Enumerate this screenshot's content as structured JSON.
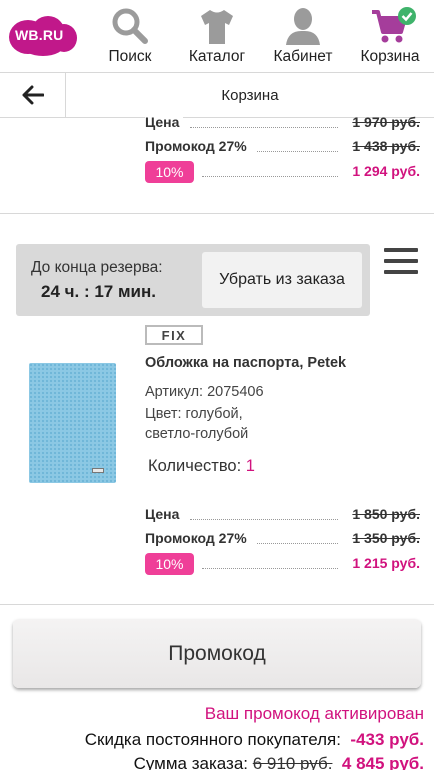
{
  "nav": {
    "logo_text": "WB.RU",
    "items": [
      {
        "label": "Поиск",
        "icon": "search-icon"
      },
      {
        "label": "Каталог",
        "icon": "tshirt-icon"
      },
      {
        "label": "Кабинет",
        "icon": "user-icon"
      },
      {
        "label": "Корзина",
        "icon": "cart-icon"
      }
    ],
    "colors": {
      "brand": "#c1188a",
      "cart": "#a53d9b",
      "check": "#3fb36b",
      "icons": "#9b9b9b"
    }
  },
  "header": {
    "title": "Корзина",
    "back_icon": "arrow-left-icon"
  },
  "item1": {
    "price_label": "Цена",
    "price": "1 970 руб.",
    "promo_label": "Промокод 27%",
    "promo_price": "1 438 руб.",
    "discount_badge": "10%",
    "final_price": "1 294 руб."
  },
  "reserve": {
    "title": "До конца резерва:",
    "time": "24 ч. : 17 мин.",
    "remove_label": "Убрать из заказа",
    "menu_icon": "hamburger-icon"
  },
  "item2": {
    "brand_badge": "FIX",
    "name": "Обложка на паспорта, Petek",
    "article": "Артикул: 2075406",
    "color_line1": "Цвет: голубой,",
    "color_line2": "светло-голубой",
    "qty_label": "Количество: ",
    "qty_value": "1",
    "price_label": "Цена",
    "price": "1 850 руб.",
    "promo_label": "Промокод 27%",
    "promo_price": "1 350 руб.",
    "discount_badge": "10%",
    "final_price": "1 215 руб."
  },
  "promo_button": "Промокод",
  "promo_activated": "Ваш промокод активирован",
  "summary": {
    "loyal_label": "Скидка постоянного покупателя:",
    "loyal_value": "-433 руб.",
    "total_label": "Сумма заказа:",
    "total_old": "6 910 руб.",
    "total_new": "4 845 руб."
  },
  "accent": "#d1127e"
}
